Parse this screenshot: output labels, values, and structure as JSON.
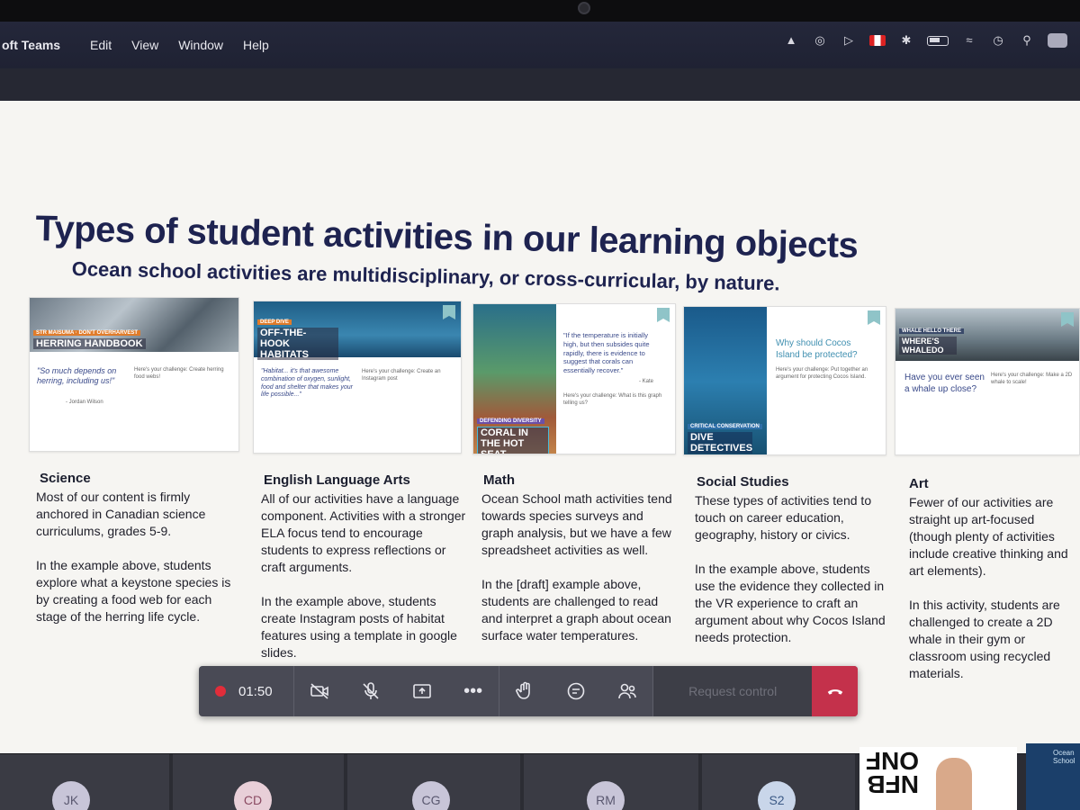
{
  "menubar": {
    "app": "oft Teams",
    "items": [
      "Edit",
      "View",
      "Window",
      "Help"
    ]
  },
  "slide": {
    "title": "Types of student activities in our learning objects",
    "subtitle": "Ocean school activities are multidisciplinary, or cross-curricular, by nature.",
    "thumbs": [
      {
        "tag": "STR MAISUMA · DON'T OVERHARVEST",
        "headline": "HERRING HANDBOOK",
        "quote": "\"So much depends on herring, including us!\"",
        "author": "- Jordan Wilson",
        "challenge": "Here's your challenge: Create herring food webs!"
      },
      {
        "tag": "DEEP DIVE",
        "headline": "OFF-THE-HOOK HABITATS",
        "quote": "\"Habitat... it's that awesome combination of oxygen, sunlight, food and shelter that makes your life possible...\"",
        "challenge": "Here's your challenge: Create an Instagram post"
      },
      {
        "tag": "DEFENDING DIVERSITY",
        "headline": "CORAL IN THE HOT SEAT",
        "quote": "\"If the temperature is initially high, but then subsides quite rapidly, there is evidence to suggest that corals can essentially recover.\"",
        "author": "- Kate",
        "challenge": "Here's your challenge: What is this graph telling us?"
      },
      {
        "tag": "CRITICAL CONSERVATION",
        "headline": "DIVE DETECTIVES",
        "quote": "Why should Cocos Island be protected?",
        "challenge": "Here's your challenge: Put together an argument for protecting Cocos Island."
      },
      {
        "tag": "WHALE HELLO THERE",
        "headline": "WHERE'S WHALEDO",
        "quote": "Have you ever seen a whale up close?",
        "challenge": "Here's your challenge: Make a 2D whale to scale!"
      }
    ],
    "columns": [
      {
        "title": "Science",
        "body": "Most of our content is firmly anchored in Canadian science curriculums, grades 5-9.\n\nIn the example above, students explore what a keystone species is by creating a food web for each stage of the herring life cycle."
      },
      {
        "title": "English Language Arts",
        "body": "All of our activities have a language component. Activities with a stronger ELA focus tend to encourage students to express reflections or craft arguments.\n\nIn the example above, students create Instagram posts of habitat features using a template in google slides."
      },
      {
        "title": "Math",
        "body": "Ocean School math activities tend towards species surveys and graph analysis, but we have a few spreadsheet activities as well.\n\nIn the [draft] example above, students are challenged to read and interpret a graph about ocean surface water temperatures."
      },
      {
        "title": "Social Studies",
        "body": "These types of activities tend to touch on career education, geography, history or civics.\n\nIn the example above, students use the evidence they collected in the VR experience to craft an argument about why Cocos Island needs protection."
      },
      {
        "title": "Art",
        "body": "Fewer of our activities are straight up art-focused (though plenty of activities include creative thinking and art elements).\n\nIn this activity, students are challenged to create a 2D whale in their gym or classroom using recycled materials."
      }
    ]
  },
  "controls": {
    "timer": "01:50",
    "request_control": "Request control"
  },
  "participants": [
    "JK",
    "CD",
    "CG",
    "RM",
    "S2"
  ],
  "nfb_logo": "NFB\nONF",
  "ocean_logo": "Ocean\nSchool",
  "colors": {
    "title": "#1e2350",
    "record": "#e12d3a",
    "hangup": "#c4314b"
  }
}
